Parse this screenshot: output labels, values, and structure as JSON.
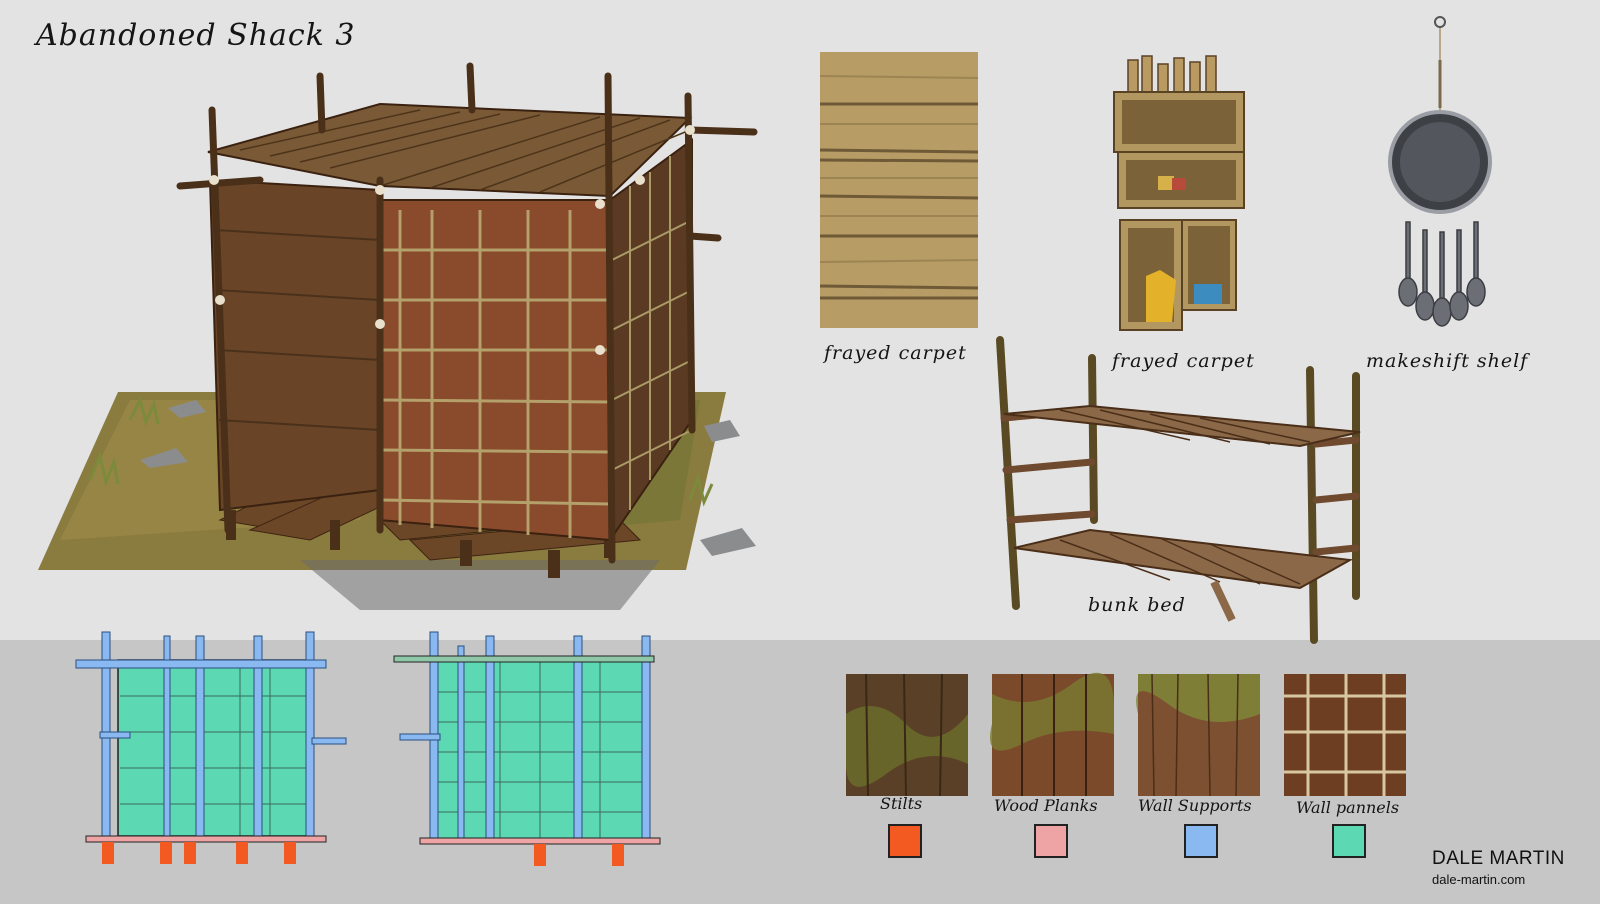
{
  "title": "Abandoned Shack 3",
  "props": [
    {
      "id": "carpet",
      "label": "frayed carpet"
    },
    {
      "id": "crate-shelf",
      "label": "frayed carpet"
    },
    {
      "id": "pan-shelf",
      "label": "makeshift shelf"
    },
    {
      "id": "bunk-bed",
      "label": "bunk bed"
    }
  ],
  "materials": [
    {
      "name": "Stilts",
      "key_color": "#f25a22"
    },
    {
      "name": "Wood Planks",
      "key_color": "#eea4a5"
    },
    {
      "name": "Wall Supports",
      "key_color": "#8ab8f0"
    },
    {
      "name": "Wall pannels",
      "key_color": "#5cd8b3"
    }
  ],
  "author": {
    "name": "DALE MARTIN",
    "website": "dale-martin.com"
  }
}
